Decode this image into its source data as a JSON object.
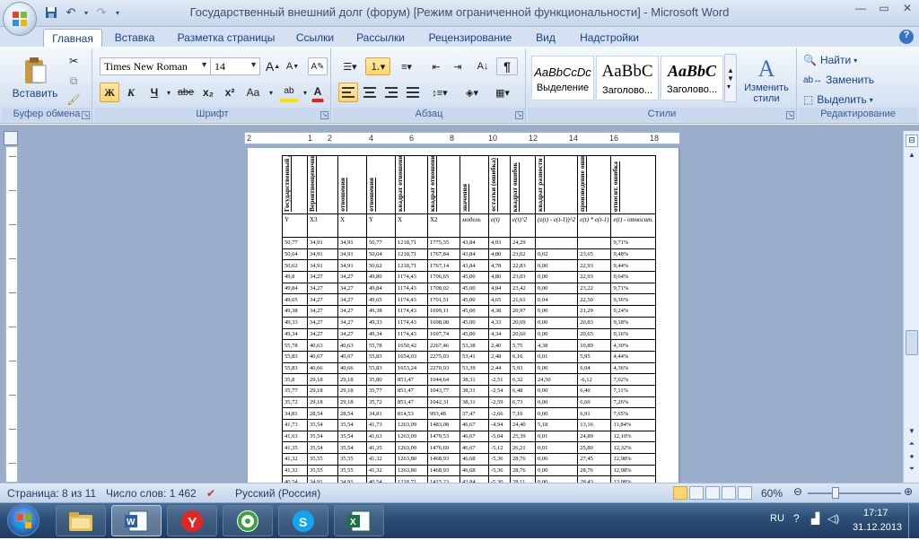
{
  "window": {
    "title": "Государственный внешний долг (форум) [Режим ограниченной функциональности] - Microsoft Word"
  },
  "tabs": [
    "Главная",
    "Вставка",
    "Разметка страницы",
    "Ссылки",
    "Рассылки",
    "Рецензирование",
    "Вид",
    "Надстройки"
  ],
  "ribbon": {
    "clipboard": {
      "paste": "Вставить",
      "label": "Буфер обмена"
    },
    "font": {
      "name": "Times New Roman",
      "size": "14",
      "label": "Шрифт",
      "bold": "Ж",
      "italic": "К",
      "underline": "Ч",
      "strike": "abe",
      "sub": "x₂",
      "sup": "x²",
      "case": "Aa",
      "grow": "A",
      "shrink": "A"
    },
    "paragraph": {
      "label": "Абзац"
    },
    "styles": {
      "label": "Стили",
      "cards": [
        {
          "sample": "AaBbCcDc",
          "name": "Выделение"
        },
        {
          "sample": "AaBbC",
          "name": "Заголово..."
        },
        {
          "sample": "AaBbC",
          "name": "Заголово..."
        }
      ],
      "change": "Изменить стили"
    },
    "editing": {
      "find": "Найти",
      "replace": "Заменить",
      "select": "Выделить",
      "label": "Редактирование"
    }
  },
  "ruler": {
    "marks": [
      "2",
      "1",
      "2",
      "4",
      "6",
      "8",
      "10",
      "12",
      "14",
      "16",
      "18"
    ]
  },
  "table": {
    "headers": [
      "Государственный долг",
      "Вероятнооценочный доход",
      "отношения",
      "отношения",
      "квадрат отношения",
      "квадрат отношения",
      "значения",
      "остатки (ошибка)",
      "квадрат ошибок",
      "квадрат разности ошибок",
      "произведение ошибок",
      "относит. ошибка"
    ],
    "subheaders": [
      "Y",
      "X3",
      "X",
      "Y",
      "X",
      "X2",
      "модель",
      "e(t)",
      "e(t)^2",
      "(e(t) - e(t-1))^2",
      "e(t) * e(t-1)",
      "e(t) - относит."
    ],
    "rows": [
      [
        "50,77",
        "34,91",
        "34,91",
        "50,77",
        "1218,71",
        "1775,35",
        "43,84",
        "4,93",
        "24,29",
        "",
        "",
        "9,71%"
      ],
      [
        "50,64",
        "34,91",
        "34,91",
        "50,64",
        "1218,71",
        "1767,84",
        "43,84",
        "4,80",
        "23,02",
        "0,02",
        "23,65",
        "9,48%"
      ],
      [
        "50,62",
        "34,91",
        "34,91",
        "50,62",
        "1218,71",
        "1767,14",
        "43,84",
        "4,78",
        "22,83",
        "0,00",
        "22,93",
        "9,44%"
      ],
      [
        "49,8",
        "34,27",
        "34,27",
        "49,80",
        "1174,43",
        "1706,65",
        "45,00",
        "4,80",
        "23,03",
        "0,00",
        "22,93",
        "9,64%"
      ],
      [
        "49,84",
        "34,27",
        "34,27",
        "49,84",
        "1174,43",
        "1708,02",
        "45,00",
        "4,84",
        "23,42",
        "0,00",
        "23,22",
        "9,71%"
      ],
      [
        "49,65",
        "34,27",
        "34,27",
        "49,65",
        "1174,43",
        "1701,51",
        "45,00",
        "4,65",
        "21,61",
        "0,04",
        "22,50",
        "9,36%"
      ],
      [
        "49,38",
        "34,27",
        "34,27",
        "49,38",
        "1174,43",
        "1699,11",
        "45,00",
        "4,38",
        "20,97",
        "0,00",
        "21,29",
        "9,24%"
      ],
      [
        "49,33",
        "34,27",
        "34,27",
        "49,33",
        "1174,43",
        "1698,08",
        "45,00",
        "4,33",
        "20,69",
        "0,00",
        "20,83",
        "9,18%"
      ],
      [
        "49,34",
        "34,27",
        "34,27",
        "49,34",
        "1174,43",
        "1697,74",
        "45,00",
        "4,34",
        "20,60",
        "0,00",
        "20,65",
        "9,16%"
      ],
      [
        "55,78",
        "40,63",
        "40,63",
        "55,78",
        "1650,42",
        "2267,46",
        "53,38",
        "2,40",
        "5,75",
        "4,38",
        "10,89",
        "4,30%"
      ],
      [
        "55,83",
        "40,67",
        "40,67",
        "55,83",
        "1654,03",
        "2275,03",
        "53,41",
        "2,48",
        "6,16",
        "0,01",
        "5,95",
        "4,44%"
      ],
      [
        "55,83",
        "40,66",
        "40,66",
        "55,83",
        "1653,24",
        "2270,03",
        "53,39",
        "2,44",
        "5,93",
        "0,00",
        "6,04",
        "4,36%"
      ],
      [
        "35,8",
        "29,18",
        "29,18",
        "35,80",
        "851,47",
        "1044,64",
        "38,31",
        "-2,51",
        "6,32",
        "24,50",
        "-6,12",
        "7,02%"
      ],
      [
        "35,77",
        "29,18",
        "29,18",
        "35,77",
        "851,47",
        "1043,77",
        "38,31",
        "-2,54",
        "6,48",
        "0,00",
        "6,40",
        "7,11%"
      ],
      [
        "35,72",
        "29,18",
        "29,18",
        "35,72",
        "851,47",
        "1042,31",
        "38,31",
        "-2,59",
        "6,73",
        "0,00",
        "6,60",
        "7,26%"
      ],
      [
        "34,81",
        "28,54",
        "28,54",
        "34,81",
        "814,53",
        "993,48",
        "37,47",
        "-2,66",
        "7,10",
        "0,00",
        "6,91",
        "7,65%"
      ],
      [
        "41,73",
        "35,54",
        "35,54",
        "41,73",
        "1263,09",
        "1483,08",
        "46,67",
        "-4,94",
        "24,40",
        "5,18",
        "13,16",
        "11,84%"
      ],
      [
        "41,63",
        "35,54",
        "35,54",
        "41,63",
        "1263,09",
        "1479,53",
        "46,67",
        "-5,04",
        "25,39",
        "0,01",
        "24,89",
        "12,10%"
      ],
      [
        "41,35",
        "35,54",
        "35,54",
        "41,35",
        "1263,09",
        "1476,69",
        "46,67",
        "-5,12",
        "26,21",
        "0,01",
        "25,80",
        "12,32%"
      ],
      [
        "41,32",
        "35,55",
        "35,55",
        "41,32",
        "1263,80",
        "1468,93",
        "46,68",
        "-5,36",
        "28,76",
        "0,06",
        "27,45",
        "12,98%"
      ],
      [
        "41,32",
        "35,55",
        "35,55",
        "41,32",
        "1263,80",
        "1468,93",
        "46,68",
        "-5,36",
        "28,76",
        "0,00",
        "28,76",
        "12,98%"
      ],
      [
        "40,54",
        "34,91",
        "34,91",
        "40,54",
        "1218,71",
        "1415,23",
        "43,84",
        "-5,30",
        "28,11",
        "0,00",
        "28,43",
        "13,08%"
      ]
    ]
  },
  "statusbar": {
    "page": "Страница: 8 из 11",
    "words": "Число слов: 1 462",
    "language": "Русский (Россия)",
    "zoom": "60%"
  },
  "taskbar": {
    "lang": "RU",
    "time": "17:17",
    "date": "31.12.2013"
  },
  "colors": {
    "ribbon_bg": "#dbe6f4",
    "workspace_bg": "#9aaecb",
    "taskbar_bg": "#2d4f77",
    "highlight": "#fbd56d"
  }
}
